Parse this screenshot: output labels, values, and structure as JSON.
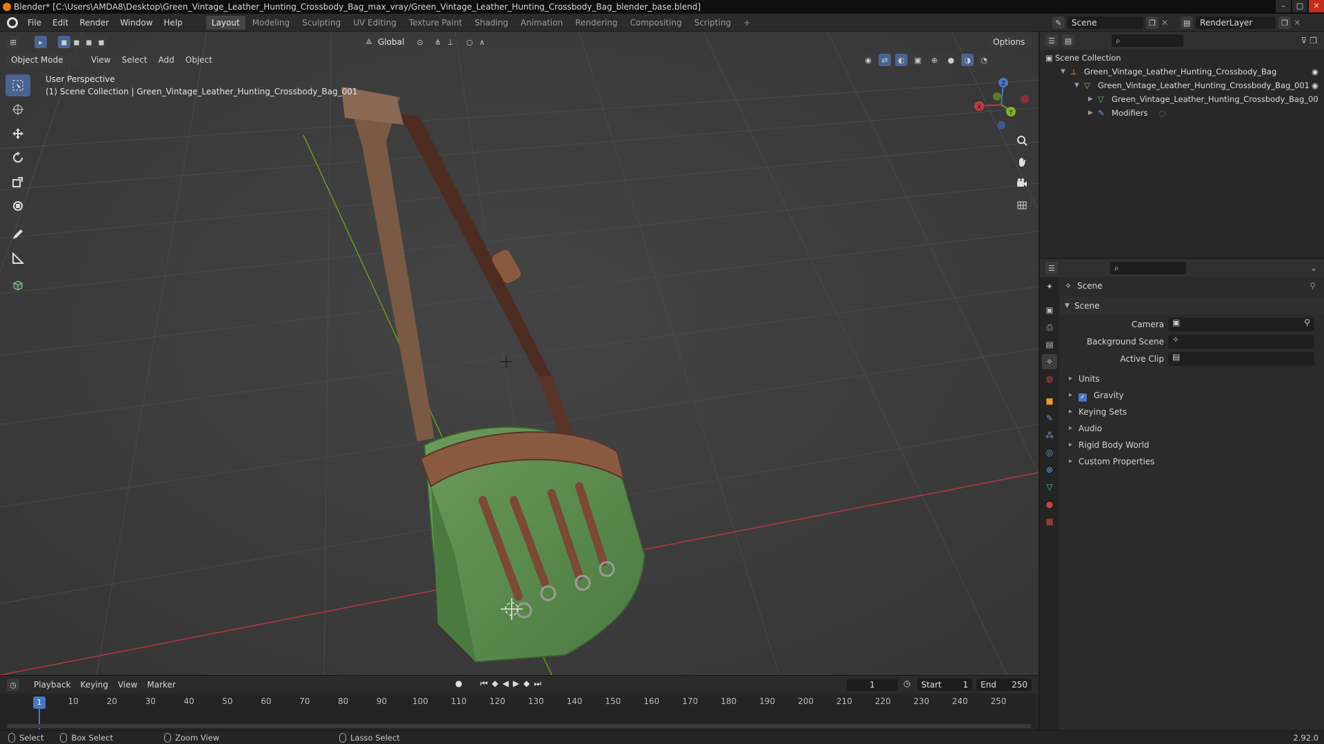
{
  "window": {
    "title": "Blender* [C:\\Users\\AMDA8\\Desktop\\Green_Vintage_Leather_Hunting_Crossbody_Bag_max_vray/Green_Vintage_Leather_Hunting_Crossbody_Bag_blender_base.blend]"
  },
  "menu": {
    "items": [
      "File",
      "Edit",
      "Render",
      "Window",
      "Help"
    ]
  },
  "workspaces": {
    "tabs": [
      "Layout",
      "Modeling",
      "Sculpting",
      "UV Editing",
      "Texture Paint",
      "Shading",
      "Animation",
      "Rendering",
      "Compositing",
      "Scripting"
    ],
    "add": "+"
  },
  "scene_selector": {
    "value": "Scene"
  },
  "render_layer": {
    "value": "RenderLayer"
  },
  "viewport_toolbar": {
    "transform_orientation": "Global",
    "options": "Options"
  },
  "viewport_header": {
    "mode": "Object Mode",
    "menus": [
      "View",
      "Select",
      "Add",
      "Object"
    ]
  },
  "viewport": {
    "perspective": "User Perspective",
    "collection_info": "(1) Scene Collection | Green_Vintage_Leather_Hunting_Crossbody_Bag_001",
    "gizmo": {
      "x": "X",
      "y": "Y",
      "z": "Z"
    }
  },
  "outliner": {
    "root": "Scene Collection",
    "items": [
      {
        "label": "Green_Vintage_Leather_Hunting_Crossbody_Bag"
      },
      {
        "label": "Green_Vintage_Leather_Hunting_Crossbody_Bag_001"
      },
      {
        "label": "Green_Vintage_Leather_Hunting_Crossbody_Bag_00"
      },
      {
        "label": "Modifiers"
      }
    ]
  },
  "properties": {
    "context": "Scene",
    "panel_title": "Scene",
    "fields": [
      {
        "label": "Camera"
      },
      {
        "label": "Background Scene"
      },
      {
        "label": "Active Clip"
      }
    ],
    "panels": [
      "Units",
      "Gravity",
      "Keying Sets",
      "Audio",
      "Rigid Body World",
      "Custom Properties"
    ],
    "gravity_checked": true
  },
  "timeline": {
    "menus": [
      "Playback",
      "Keying",
      "View",
      "Marker"
    ],
    "current_frame": "1",
    "start_label": "Start",
    "start": "1",
    "end_label": "End",
    "end": "250",
    "ticks": [
      "1",
      "10",
      "20",
      "30",
      "40",
      "50",
      "60",
      "70",
      "80",
      "90",
      "100",
      "110",
      "120",
      "130",
      "140",
      "150",
      "160",
      "170",
      "180",
      "190",
      "200",
      "210",
      "220",
      "230",
      "240",
      "250"
    ]
  },
  "statusbar": {
    "select": "Select",
    "box_select": "Box Select",
    "zoom_view": "Zoom View",
    "lasso_select": "Lasso Select",
    "version": "2.92.0"
  },
  "colors": {
    "accent_orange": "#e87d0d",
    "selection_blue": "#4a78c4",
    "bag_green": "#5a8a4e",
    "leather_brown": "#7a4a34",
    "axis_red": "#b8363f",
    "axis_green": "#6c9a1f"
  }
}
